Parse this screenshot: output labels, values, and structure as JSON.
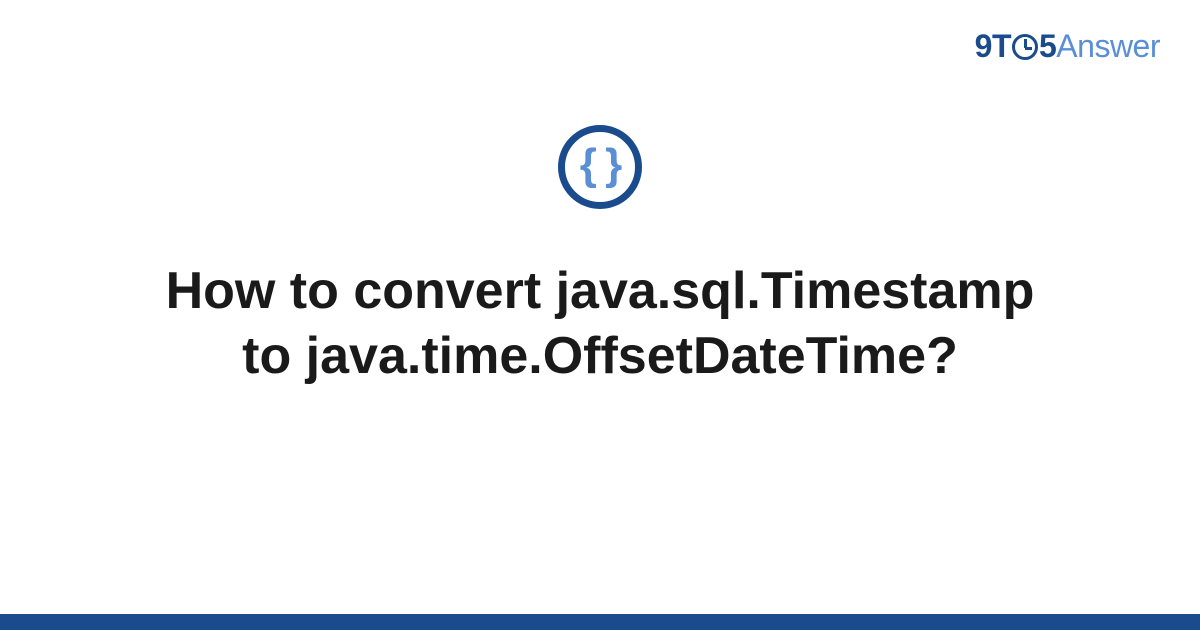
{
  "logo": {
    "part1": "9T",
    "part2": "5",
    "part3": "Answer"
  },
  "icon": {
    "braces": "{ }",
    "name": "code-braces-icon"
  },
  "title": "How to convert java.sql.Timestamp to java.time.OffsetDateTime?",
  "colors": {
    "primary": "#1a4b8c",
    "secondary": "#5a8fd6",
    "text": "#1a1a1a"
  }
}
